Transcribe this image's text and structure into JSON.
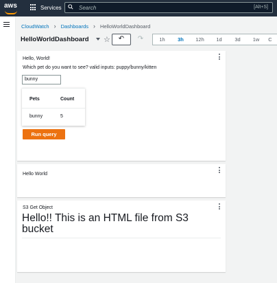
{
  "nav": {
    "logo": "aws",
    "services_label": "Services",
    "search_placeholder": "Search",
    "search_shortcut": "[Alt+S]"
  },
  "breadcrumb": {
    "items": [
      "CloudWatch",
      "Dashboards",
      "HelloWorldDashboard"
    ]
  },
  "dashboard": {
    "title": "HelloWorldDashboard",
    "undo_icon": "undo-icon",
    "redo_icon": "redo-icon",
    "time_ranges": [
      "1h",
      "3h",
      "12h",
      "1d",
      "3d",
      "1w",
      "C"
    ],
    "selected_range": "3h"
  },
  "widgets": {
    "query": {
      "title": "Hello, World!",
      "prompt": "Which pet do you want to see? valid inputs: puppy/bunny/kitten",
      "input_value": "bunny",
      "table": {
        "headers": [
          "Pets",
          "Count"
        ],
        "rows": [
          [
            "bunny",
            "5"
          ]
        ]
      },
      "run_label": "Run query"
    },
    "hello": {
      "title": "Hello World"
    },
    "s3": {
      "title": "S3 Get Object",
      "content": "Hello!! This is an HTML file from S3 bucket"
    }
  },
  "colors": {
    "nav_bg": "#232f3e",
    "link": "#0073bb",
    "accent": "#ec7211",
    "logo_smile": "#ff9900"
  }
}
